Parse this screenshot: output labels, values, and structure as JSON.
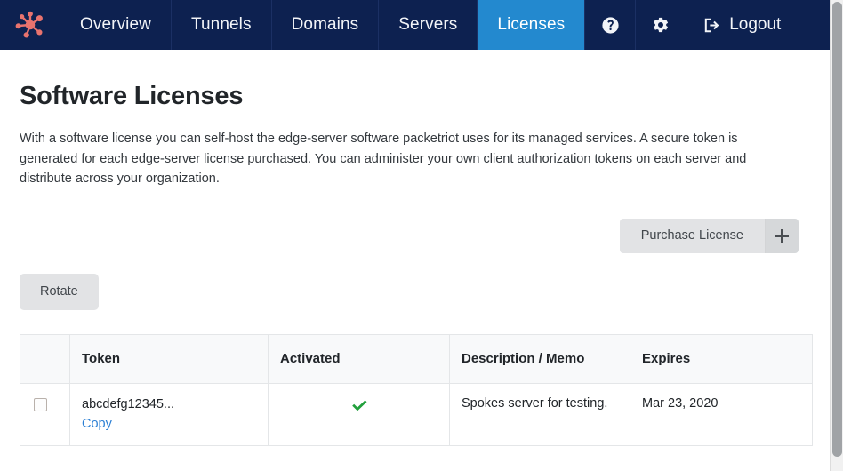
{
  "navbar": {
    "brand_icon": "packetriot-hub-logo",
    "brand_color": "#e8736e",
    "background_color": "#0d2150",
    "active_color": "#2389cf",
    "items": [
      {
        "label": "Overview",
        "active": false
      },
      {
        "label": "Tunnels",
        "active": false
      },
      {
        "label": "Domains",
        "active": false
      },
      {
        "label": "Servers",
        "active": false
      },
      {
        "label": "Licenses",
        "active": true
      }
    ],
    "help_icon": "question-circle-icon",
    "settings_icon": "gear-icon",
    "logout_icon": "sign-out-icon",
    "logout_label": "Logout"
  },
  "main": {
    "title": "Software Licenses",
    "description": "With a software license you can self-host the edge-server software packetriot uses for its managed services. A secure token is generated for each edge-server license purchased. You can administer your own client authorization tokens on each server and distribute across your organization.",
    "purchase_button": {
      "label": "Purchase License",
      "plus_icon": "plus-icon"
    },
    "rotate_button": {
      "label": "Rotate"
    },
    "table": {
      "columns": [
        {
          "key": "select",
          "label": ""
        },
        {
          "key": "token",
          "label": "Token"
        },
        {
          "key": "activated",
          "label": "Activated"
        },
        {
          "key": "description",
          "label": "Description / Memo"
        },
        {
          "key": "expires",
          "label": "Expires"
        }
      ],
      "rows": [
        {
          "selected": false,
          "token": "abcdefg12345...",
          "copy_label": "Copy",
          "activated": true,
          "activated_icon": "check-icon",
          "activated_color": "#22a03c",
          "description": "Spokes server for testing.",
          "expires": "Mar 23, 2020"
        }
      ]
    }
  },
  "scrollbar": {
    "orientation": "vertical"
  }
}
